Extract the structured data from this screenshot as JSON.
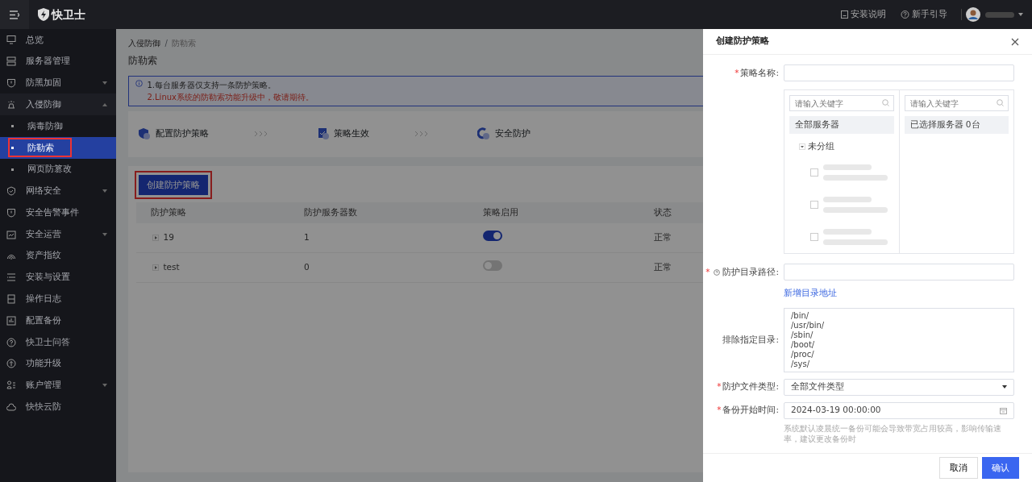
{
  "topbar": {
    "logo_text": "快卫士",
    "links": [
      {
        "label": "安装说明"
      },
      {
        "label": "新手引导"
      }
    ]
  },
  "sidebar": {
    "items": [
      {
        "label": "总览",
        "selected": false
      },
      {
        "label": "服务器管理",
        "selected": false
      },
      {
        "label": "防黑加固",
        "selected": false,
        "expanded": false
      },
      {
        "label": "入侵防御",
        "selected": false,
        "expanded": true,
        "children": [
          {
            "label": "病毒防御",
            "selected": false,
            "highlighted": false
          },
          {
            "label": "防勒索",
            "selected": true,
            "highlighted": true
          },
          {
            "label": "网页防篡改",
            "selected": false,
            "highlighted": false
          }
        ]
      },
      {
        "label": "网络安全",
        "selected": false,
        "expanded": false
      },
      {
        "label": "安全告警事件",
        "selected": false
      },
      {
        "label": "安全运营",
        "selected": false,
        "expanded": false
      },
      {
        "label": "资产指纹",
        "selected": false
      },
      {
        "label": "安装与设置",
        "selected": false
      },
      {
        "label": "操作日志",
        "selected": false
      },
      {
        "label": "配置备份",
        "selected": false
      },
      {
        "label": "快卫士问答",
        "selected": false
      },
      {
        "label": "功能升级",
        "selected": false
      },
      {
        "label": "账户管理",
        "selected": false,
        "expanded": false
      },
      {
        "label": "快快云防",
        "selected": false
      }
    ]
  },
  "breadcrumb": [
    {
      "label": "入侵防御"
    },
    {
      "label": "防勒索"
    }
  ],
  "breadcrumb_separator": "/",
  "page_title": "防勒索",
  "notices": [
    {
      "text": "1.每台服务器仅支持一条防护策略。",
      "kind": "info"
    },
    {
      "text": "2.Linux系统的防勒索功能升级中，敬请期待。",
      "kind": "warning"
    }
  ],
  "steps": [
    {
      "label": "配置防护策略"
    },
    {
      "label": "策略生效"
    },
    {
      "label": "安全防护"
    }
  ],
  "create_button": {
    "label": "创建防护策略",
    "highlighted": true
  },
  "table": {
    "columns": [
      "防护策略",
      "防护服务器数",
      "策略启用",
      "状态"
    ],
    "rows": [
      {
        "name": "19",
        "servers": "1",
        "on": true,
        "status": "正常"
      },
      {
        "name": "test",
        "servers": "0",
        "on": false,
        "status": "正常"
      }
    ]
  },
  "drawer": {
    "title": "创建防护策略",
    "name_field": {
      "label": "策略名称:",
      "required_mark": "*"
    },
    "transfer": {
      "left": {
        "placeholder": "请输入关键字",
        "header": "全部服务器",
        "group": "未分组",
        "group_expanded": true,
        "servers": [
          {
            "checked": false
          },
          {
            "checked": false
          },
          {
            "checked": false
          }
        ]
      },
      "right": {
        "placeholder": "请输入关键字",
        "header": "已选择服务器 0台"
      }
    },
    "path_field": {
      "label": "防护目录路径:",
      "required_mark": "*"
    },
    "add_link": "新增目录地址",
    "exclude": {
      "label": "排除指定目录:",
      "lines": [
        "/bin/",
        "/usr/bin/",
        "/sbin/",
        "/boot/",
        "/proc/",
        "/sys/"
      ]
    },
    "file_type": {
      "label": "防护文件类型:",
      "required_mark": "*",
      "value": "全部文件类型"
    },
    "start_time": {
      "label": "备份开始时间:",
      "required_mark": "*",
      "value": "2024-03-19 00:00:00"
    },
    "hint": "系统默认凌晨统一备份可能会导致带宽占用较高，影响传输速率，建议更改备份时",
    "cancel": "取消",
    "confirm": "确认"
  }
}
